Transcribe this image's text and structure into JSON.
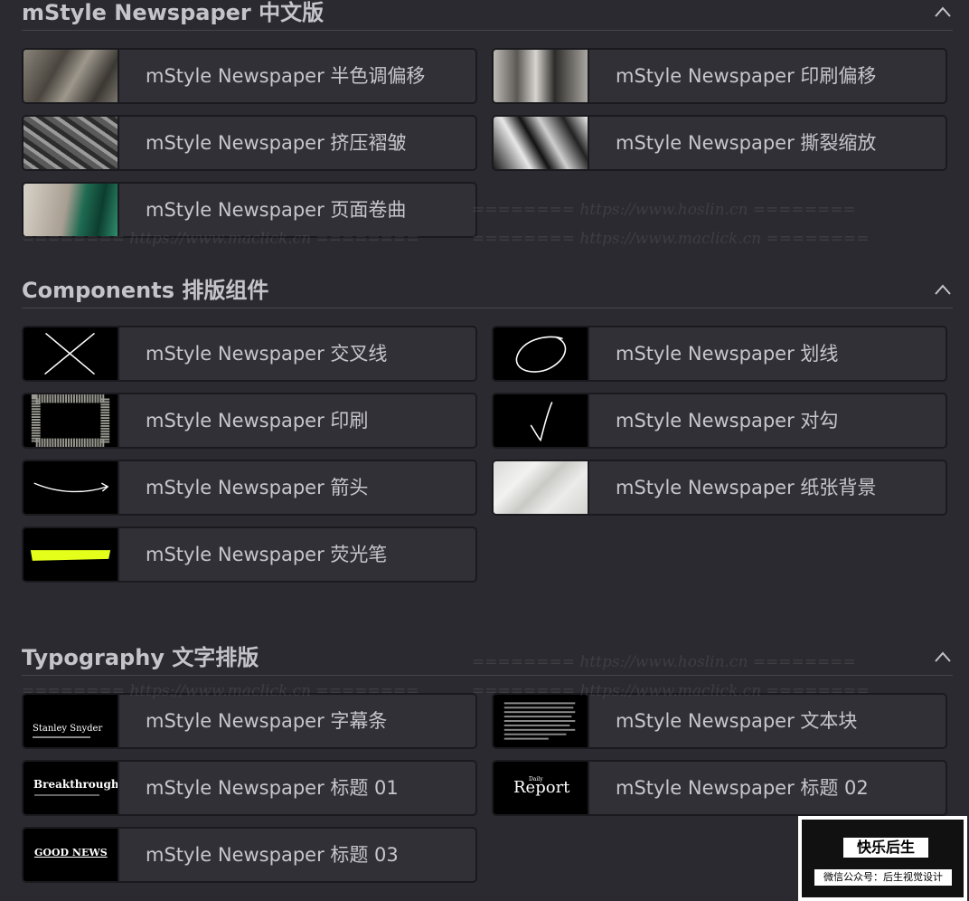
{
  "sections": [
    {
      "title": "mStyle Newspaper 中文版",
      "items": [
        {
          "label": "mStyle Newspaper 半色调偏移"
        },
        {
          "label": "mStyle Newspaper 印刷偏移"
        },
        {
          "label": "mStyle Newspaper 挤压褶皱"
        },
        {
          "label": "mStyle Newspaper 撕裂缩放"
        },
        {
          "label": "mStyle Newspaper 页面卷曲"
        }
      ]
    },
    {
      "title": "Components 排版组件",
      "items": [
        {
          "label": "mStyle Newspaper 交叉线"
        },
        {
          "label": "mStyle Newspaper 划线"
        },
        {
          "label": "mStyle Newspaper 印刷"
        },
        {
          "label": "mStyle Newspaper 对勾"
        },
        {
          "label": "mStyle Newspaper 箭头"
        },
        {
          "label": "mStyle Newspaper 纸张背景"
        },
        {
          "label": "mStyle Newspaper 荧光笔"
        }
      ]
    },
    {
      "title": "Typography 文字排版",
      "items": [
        {
          "label": "mStyle Newspaper 字幕条"
        },
        {
          "label": "mStyle Newspaper 文本块"
        },
        {
          "label": "mStyle Newspaper 标题 01"
        },
        {
          "label": "mStyle Newspaper 标题 02"
        },
        {
          "label": "mStyle Newspaper 标题 03"
        }
      ]
    }
  ],
  "thumbnails": {
    "lower_third_name": "Stanley Snyder",
    "title01_text": "Breakthrough",
    "title02_small": "Daily",
    "title02_text": "Report",
    "title03_text": "GOOD NEWS"
  },
  "watermarks": {
    "hoslin": "======== https://www.hoslin.cn ========",
    "maclick": "======== https://www.maclick.cn ========"
  },
  "badge": {
    "title": "快乐后生",
    "subtitle": "微信公众号：后生视觉设计"
  },
  "colors": {
    "background": "#2a2a30",
    "card": "#303036",
    "highlighter": "#e4ff1a"
  }
}
